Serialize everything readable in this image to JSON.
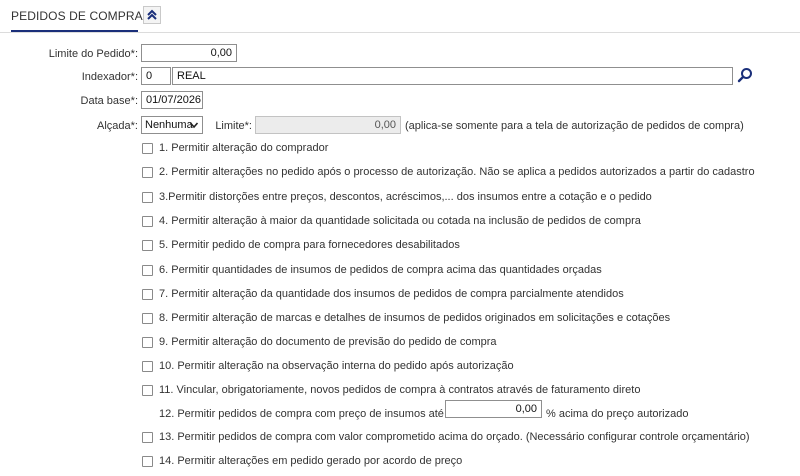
{
  "header": {
    "title": "PEDIDOS DE COMPRA",
    "collapse_icon": "double-chevron-up-icon"
  },
  "form": {
    "limite_pedido": {
      "label": "Limite do Pedido*:",
      "value": "0,00"
    },
    "indexador": {
      "label": "Indexador*:",
      "code": "0",
      "name": "REAL"
    },
    "data_base": {
      "label": "Data base*:",
      "value": "01/07/2026"
    },
    "alcada": {
      "label": "Alçada*:",
      "selected": "Nenhuma"
    },
    "limite": {
      "label": "Limite*:",
      "value": "0,00",
      "note": "(aplica-se somente para a tela de autorização de pedidos de compra)"
    }
  },
  "options": [
    {
      "label": "1. Permitir alteração do comprador",
      "checked": false
    },
    {
      "label": "2. Permitir alterações no pedido após o processo de autorização. Não se aplica a pedidos autorizados a partir do cadastro",
      "checked": false
    },
    {
      "label": "3.Permitir distorções entre preços, descontos, acréscimos,... dos insumos entre a cotação e o pedido",
      "checked": false
    },
    {
      "label": "4. Permitir alteração à maior da quantidade solicitada ou cotada na inclusão de pedidos de compra",
      "checked": false
    },
    {
      "label": "5. Permitir pedido de compra para fornecedores desabilitados",
      "checked": false
    },
    {
      "label": "6. Permitir quantidades de insumos de pedidos de compra acima das quantidades orçadas",
      "checked": false
    },
    {
      "label": "7. Permitir alteração da quantidade dos insumos de pedidos de compra parcialmente atendidos",
      "checked": false
    },
    {
      "label": "8. Permitir alteração de marcas e detalhes de insumos de pedidos originados em solicitações e cotações",
      "checked": false
    },
    {
      "label": "9. Permitir alteração do documento de previsão do pedido de compra",
      "checked": false
    },
    {
      "label": "10. Permitir alteração na observação interna do pedido após autorização",
      "checked": false
    },
    {
      "label": "11. Vincular, obrigatoriamente, novos pedidos de compra à contratos através de faturamento direto",
      "checked": false
    }
  ],
  "option12": {
    "label_before": "12. Permitir pedidos de compra com preço de insumos até",
    "value": "0,00",
    "label_after": "% acima do preço autorizado"
  },
  "options_tail": [
    {
      "label": "13. Permitir pedidos de compra com valor comprometido acima do orçado. (Necessário configurar controle orçamentário)",
      "checked": false
    },
    {
      "label": "14. Permitir alterações em pedido gerado por acordo de preço",
      "checked": false
    }
  ]
}
